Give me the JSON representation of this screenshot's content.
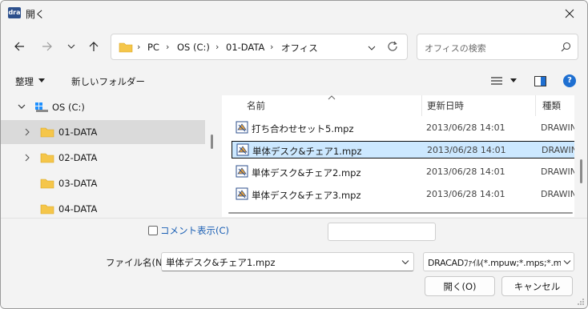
{
  "window": {
    "app_icon_text": "dra",
    "title": "開く"
  },
  "address": {
    "crumbs": [
      "PC",
      "OS (C:)",
      "01-DATA",
      "オフィス"
    ]
  },
  "search": {
    "placeholder": "オフィスの検索"
  },
  "toolbar": {
    "organize_label": "整理",
    "new_folder_label": "新しいフォルダー",
    "help_label": "?"
  },
  "nav_pane": {
    "drive": {
      "label": "OS (C:)"
    },
    "folders": [
      {
        "label": "01-DATA",
        "selected": true,
        "expandable": true
      },
      {
        "label": "02-DATA",
        "selected": false,
        "expandable": true
      },
      {
        "label": "03-DATA",
        "selected": false,
        "expandable": false
      },
      {
        "label": "04-DATA",
        "selected": false,
        "expandable": false
      }
    ]
  },
  "file_list": {
    "columns": {
      "name": "名前",
      "date": "更新日時",
      "type": "種類"
    },
    "rows": [
      {
        "name": "打ち合わせセット5.mpz",
        "date": "2013/06/28 14:01",
        "type": "DRAWIN",
        "selected": false
      },
      {
        "name": "単体デスク&チェア1.mpz",
        "date": "2013/06/28 14:01",
        "type": "DRAWIN",
        "selected": true
      },
      {
        "name": "単体デスク&チェア2.mpz",
        "date": "2013/06/28 14:01",
        "type": "DRAWIN",
        "selected": false
      },
      {
        "name": "単体デスク&チェア3.mpz",
        "date": "2013/06/28 14:01",
        "type": "DRAWIN",
        "selected": false
      }
    ]
  },
  "comment": {
    "label": "コメント表示(C)",
    "checked": false,
    "value": ""
  },
  "filename": {
    "label": "ファイル名(N):",
    "value": "単体デスク&チェア1.mpz"
  },
  "filetype": {
    "value": "DRACADﾌｧｲﾙ(*.mpuw;*.mps;*.m"
  },
  "buttons": {
    "open_label": "開く(O)",
    "cancel_label": "キャンセル"
  },
  "colors": {
    "accent": "#1e6fd1",
    "selection": "#cce8ff",
    "folder": "#f5c64a"
  }
}
